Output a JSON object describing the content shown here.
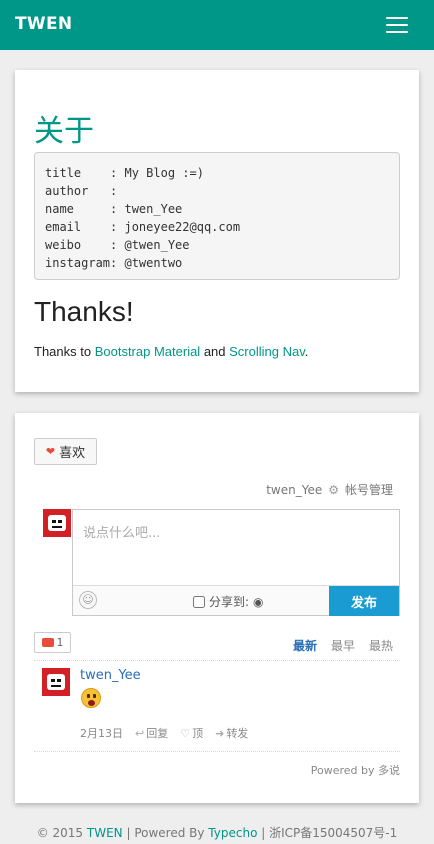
{
  "nav": {
    "brand": "TWEN",
    "menu_icon": "hamburger-icon"
  },
  "about": {
    "title": "关于",
    "info": "title    : My Blog :=)\nauthor   :\nname     : twen_Yee\nemail    : joneyee22@qq.com\nweibo    : @twen_Yee\ninstagram: @twentwo",
    "thanks_title": "Thanks!",
    "thanks_prefix": "Thanks to ",
    "link1": "Bootstrap Material",
    "thanks_mid": " and ",
    "link2": "Scrolling Nav",
    "thanks_suffix": "."
  },
  "comments": {
    "like_label": "喜欢",
    "user": "twen_Yee",
    "account_manage": "帐号管理",
    "placeholder": "说点什么吧...",
    "share_label": "分享到:",
    "publish_label": "发布",
    "count": "1",
    "tabs": {
      "newest": "最新",
      "oldest": "最早",
      "hottest": "最热"
    },
    "item": {
      "name": "twen_Yee",
      "date": "2月13日",
      "reply": "回复",
      "upvote": "顶",
      "forward": "转发"
    },
    "powered_by": "Powered by 多说"
  },
  "footer": {
    "copyright": "© 2015 ",
    "brand": "TWEN",
    "sep1": " | Powered By ",
    "typecho": "Typecho",
    "icp": " | 浙ICP备15004507号-1"
  },
  "colors": {
    "primary": "#009688",
    "link_blue": "#2a6eb5",
    "publish": "#1a9bd1"
  }
}
